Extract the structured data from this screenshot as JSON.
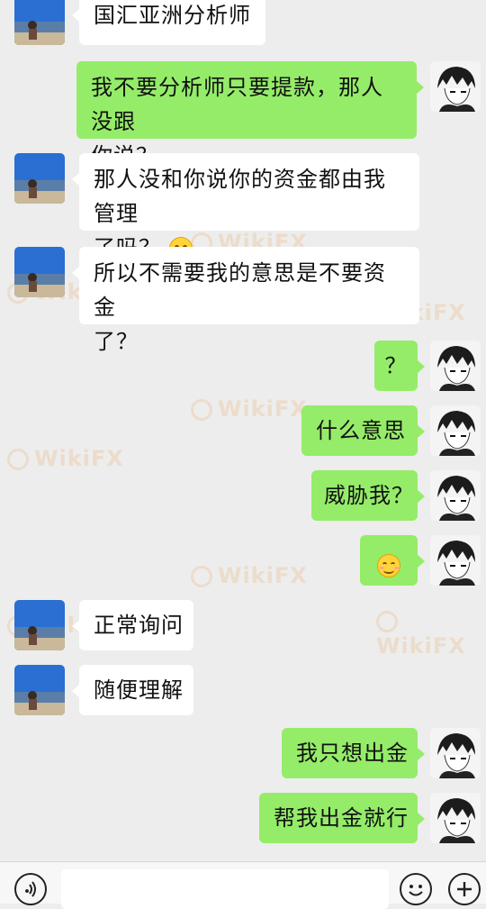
{
  "watermark": {
    "text": "WikiFX"
  },
  "messages": [
    {
      "side": "left",
      "text": "国汇亚洲分析师"
    },
    {
      "side": "right",
      "text": "我不要分析师只要提款，那人没跟你说？",
      "line1": "我不要分析师只要提款，那人没跟",
      "line2": "你说？"
    },
    {
      "side": "left",
      "text": "那人没和你说你的资金都由我管理了吗？",
      "line1": "那人没和你说你的资金都由我管理",
      "line2": "了吗？",
      "emoji": "smile-blush-emoji"
    },
    {
      "side": "left",
      "text": "所以不需要我的意思是不要资金了？",
      "line1": "所以不需要我的意思是不要资金",
      "line2": "了？"
    },
    {
      "side": "right",
      "text": "？"
    },
    {
      "side": "right",
      "text": "什么意思"
    },
    {
      "side": "right",
      "text": "威胁我？"
    },
    {
      "side": "right",
      "emoji": "smile-blush-emoji"
    },
    {
      "side": "left",
      "text": "正常询问"
    },
    {
      "side": "left",
      "text": "随便理解"
    },
    {
      "side": "right",
      "text": "我只想出金"
    },
    {
      "side": "right",
      "text": "帮我出金就行"
    }
  ],
  "input_bar": {
    "voice_icon": "voice-icon",
    "emoji_icon": "emoji-face-icon",
    "plus_icon": "plus-icon"
  },
  "colors": {
    "background": "#ededed",
    "my_bubble": "#95ec69",
    "their_bubble": "#ffffff"
  }
}
